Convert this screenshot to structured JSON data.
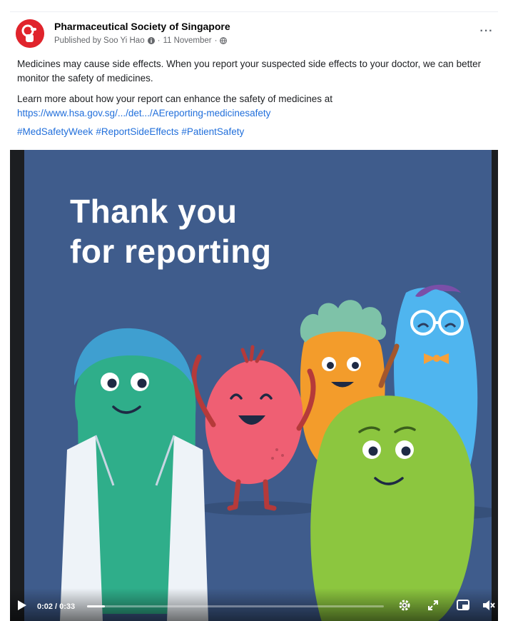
{
  "post": {
    "page_name": "Pharmaceutical Society of Singapore",
    "published_by": "Published by Soo Yi Hao",
    "date": "11 November",
    "more_label": "···",
    "body_line_1": "Medicines may cause side effects. When you report your suspected side effects to your doctor, we can better monitor the safety of medicines.",
    "body_line_2": "Learn more about how your report can enhance the safety of medicines at",
    "link_text": "https://www.hsa.gov.sg/.../det.../AEreporting-medicinesafety",
    "hashtags": [
      "#MedSafetyWeek",
      "#ReportSideEffects",
      "#PatientSafety"
    ]
  },
  "video": {
    "headline_line_1": "Thank you",
    "headline_line_2": "for reporting",
    "current_time": "0:02",
    "separator": "/",
    "duration": "0:33",
    "progress": 0.06,
    "icons": [
      "play-icon",
      "settings-icon",
      "fullscreen-icon",
      "picture-in-picture-icon",
      "volume-muted-icon"
    ]
  },
  "colors": {
    "brand_red": "#e0242c",
    "video_bg": "#3f5c8c",
    "link_blue": "#216fdb"
  }
}
